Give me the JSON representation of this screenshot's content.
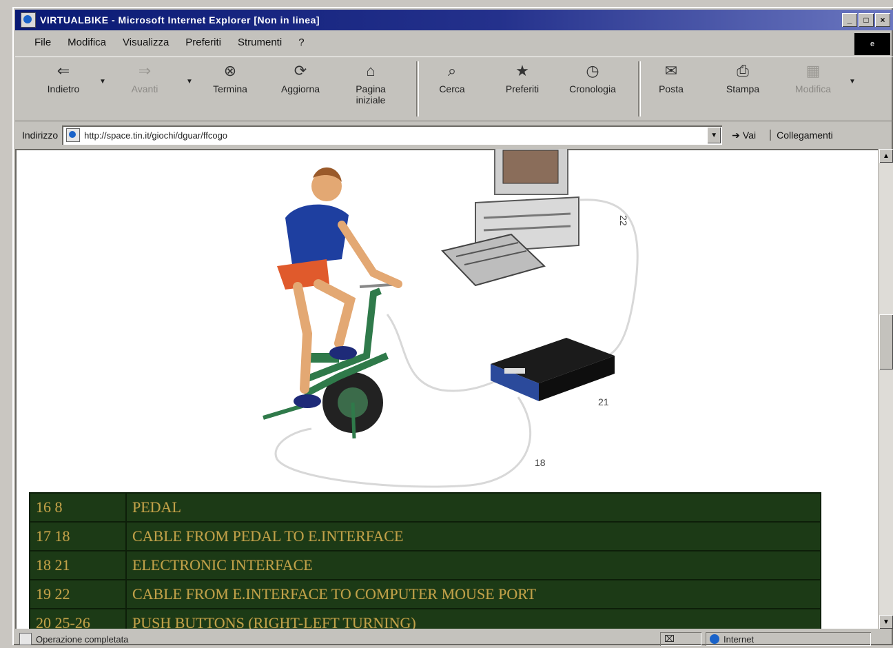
{
  "window": {
    "title": "VIRTUALBIKE - Microsoft Internet Explorer [Non in linea]"
  },
  "menu": [
    "File",
    "Modifica",
    "Visualizza",
    "Preferiti",
    "Strumenti",
    "?"
  ],
  "toolbar": {
    "back": "Indietro",
    "forward": "Avanti",
    "stop": "Termina",
    "refresh": "Aggiorna",
    "home": "Pagina iniziale",
    "search": "Cerca",
    "favorites": "Preferiti",
    "history": "Cronologia",
    "mail": "Posta",
    "print": "Stampa",
    "edit": "Modifica"
  },
  "address": {
    "label": "Indirizzo",
    "value": "http://space.tin.it/giochi/dguar/ffcogo",
    "go_label": "Vai",
    "links_label": "Collegamenti"
  },
  "diagram_labels": {
    "cable_top": "22",
    "interface": "21",
    "cable_bottom": "18"
  },
  "legend_rows": [
    {
      "code": "16 8",
      "description": "PEDAL"
    },
    {
      "code": "17 18",
      "description": "CABLE FROM PEDAL TO E.INTERFACE"
    },
    {
      "code": "18 21",
      "description": "ELECTRONIC INTERFACE"
    },
    {
      "code": "19 22",
      "description": "CABLE FROM E.INTERFACE TO COMPUTER MOUSE PORT"
    },
    {
      "code": "20 25-26",
      "description": "PUSH BUTTONS (RIGHT-LEFT TURNING)"
    }
  ],
  "status": {
    "text": "Operazione completata",
    "zone": "Internet"
  },
  "colors": {
    "title_bar": "#0a1a74",
    "legend_bg": "#1c3a16",
    "legend_text": "#bfa24a"
  },
  "icons": [
    "back-arrow-icon",
    "forward-arrow-icon",
    "stop-icon",
    "refresh-icon",
    "home-icon",
    "search-icon",
    "favorites-icon",
    "history-icon",
    "mail-icon",
    "print-icon",
    "edit-icon"
  ]
}
